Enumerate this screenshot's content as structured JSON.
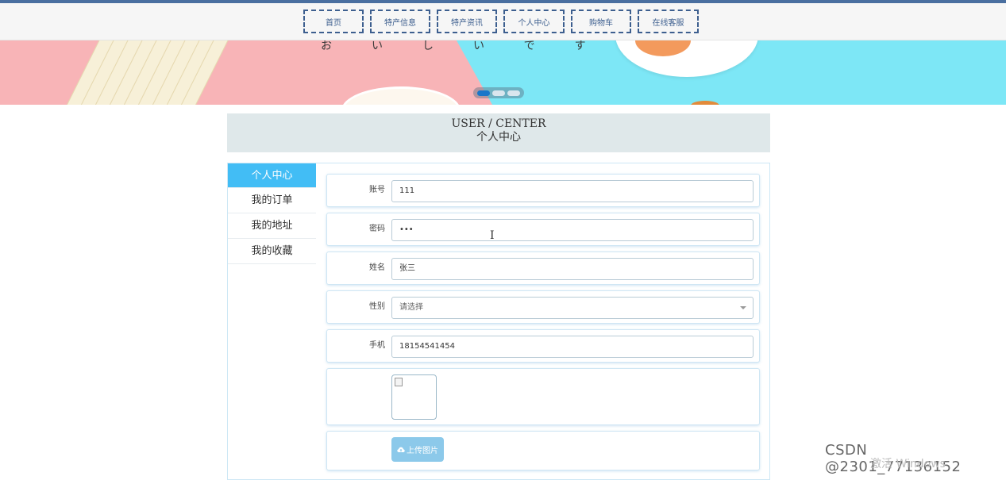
{
  "nav": {
    "items": [
      {
        "label": "首页",
        "width": 76
      },
      {
        "label": "特产信息",
        "width": 76
      },
      {
        "label": "特产资讯",
        "width": 76
      },
      {
        "label": "个人中心",
        "width": 77
      },
      {
        "label": "购物车",
        "width": 76
      },
      {
        "label": "在线客服",
        "width": 77
      }
    ]
  },
  "banner": {
    "text": "おいしいです"
  },
  "header": {
    "title_en": "USER / CENTER",
    "title_cn": "个人中心"
  },
  "sidebar": {
    "items": [
      "个人中心",
      "我的订单",
      "我的地址",
      "我的收藏"
    ]
  },
  "form": {
    "account_label": "账号",
    "account_value": "111",
    "password_label": "密码",
    "password_value": "•••",
    "name_label": "姓名",
    "name_value": "张三",
    "gender_label": "性别",
    "gender_placeholder": "请选择",
    "phone_label": "手机",
    "phone_value": "18154541454",
    "upload_label": "上传图片"
  },
  "cursor_glyph": "I",
  "watermark": "CSDN @2301_77136152",
  "windows_activation": "激活 Windows"
}
